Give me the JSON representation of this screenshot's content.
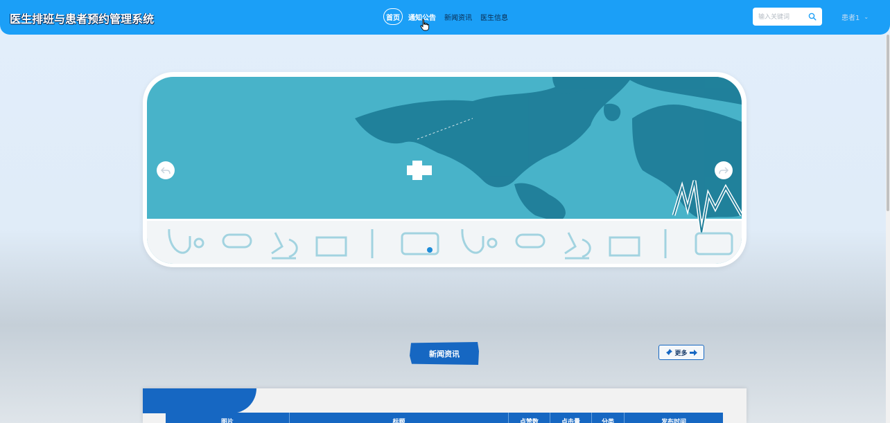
{
  "header": {
    "site_title": "医生排班与患者预约管理系统",
    "nav": [
      {
        "label": "首页",
        "active": true
      },
      {
        "label": "通知公告"
      },
      {
        "label": "新闻资讯"
      },
      {
        "label": "医生信息"
      }
    ],
    "search_placeholder": "输入关键词",
    "user_label": "患者1",
    "accent": "#1b9ff7"
  },
  "news": {
    "title": "新闻资讯",
    "more_label": "更多",
    "columns": [
      "图片",
      "标题",
      "点赞数",
      "点击量",
      "分类",
      "发布时间"
    ],
    "accent": "#1667c2"
  }
}
